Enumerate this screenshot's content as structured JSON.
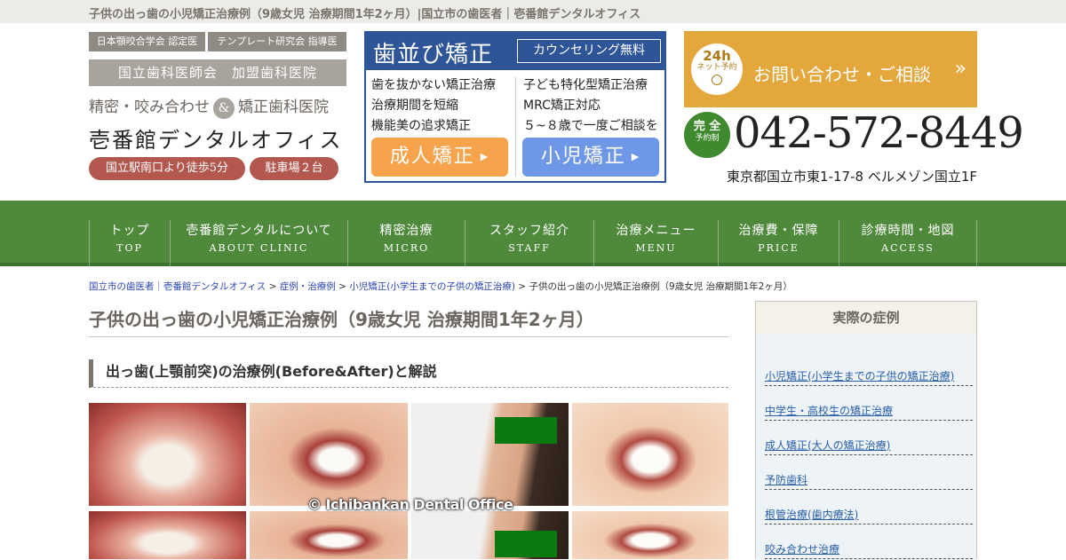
{
  "page": {
    "title": "子供の出っ歯の小児矯正治療例（9歳女児 治療期間1年2ヶ月）|国立市の歯医者｜壱番館デンタルオフィス"
  },
  "header": {
    "tags": [
      "日本顎咬合学会 認定医",
      "テンプレート研究会 指導医"
    ],
    "association": "国立歯科医師会　加盟歯科医院",
    "tagline_left": "精密・咬み合わせ",
    "amp": "&",
    "tagline_right": "矯正歯科医院",
    "clinic_name": "壱番館デンタルオフィス",
    "pills": [
      "国立駅南口より徒歩5分",
      "駐車場２台"
    ]
  },
  "promo": {
    "title": "歯並び矯正",
    "subtitle": "カウンセリング無料",
    "left_lines": [
      "歯を抜かない矯正治療",
      "治療期間を短縮",
      "機能美の追求矯正"
    ],
    "right_lines": [
      "子ども特化型矯正治療",
      "MRC矯正対応",
      "５~８歳で一度ご相談を"
    ],
    "adult_button": "成人矯正",
    "child_button": "小児矯正",
    "adult_color": "#f7a34b",
    "child_color": "#6f97e8"
  },
  "contact": {
    "badge_top": "24h",
    "badge_bottom": "ネット予約",
    "cta_text": "お問い合わせ・ご相談",
    "cta_arrow": "»",
    "tel_badge_top": "完 全",
    "tel_badge_bottom": "予約制",
    "tel": "042-572-8449",
    "address": "東京都国立市東1-17-8 ベルメゾン国立1F"
  },
  "nav": [
    {
      "jp": "トップ",
      "en": "TOP"
    },
    {
      "jp": "壱番館デンタルについて",
      "en": "ABOUT CLINIC"
    },
    {
      "jp": "精密治療",
      "en": "MICRO"
    },
    {
      "jp": "スタッフ紹介",
      "en": "STAFF"
    },
    {
      "jp": "治療メニュー",
      "en": "MENU"
    },
    {
      "jp": "治療費・保障",
      "en": "PRICE"
    },
    {
      "jp": "診療時間・地図",
      "en": "ACCESS"
    }
  ],
  "breadcrumb": {
    "links": [
      "国立市の歯医者｜壱番館デンタルオフィス",
      "症例・治療例",
      "小児矯正(小学生までの子供の矯正治療)"
    ],
    "separator": " > ",
    "current": "子供の出っ歯の小児矯正治療例（9歳女児 治療期間1年2ヶ月）"
  },
  "main": {
    "page_title": "子供の出っ歯の小児矯正治療例（9歳女児 治療期間1年2ヶ月）",
    "section_title": "出っ歯(上顎前突)の治療例(Before&After)と解説",
    "watermark": "© Ichibankan Dental Office"
  },
  "sidebar": {
    "title": "実際の症例",
    "items": [
      "小児矯正(小学生までの子供の矯正治療)",
      "中学生・高校生の矯正治療",
      "成人矯正(大人の矯正治療)",
      "予防歯科",
      "根管治療(歯内療法)",
      "咬み合わせ治療"
    ]
  }
}
